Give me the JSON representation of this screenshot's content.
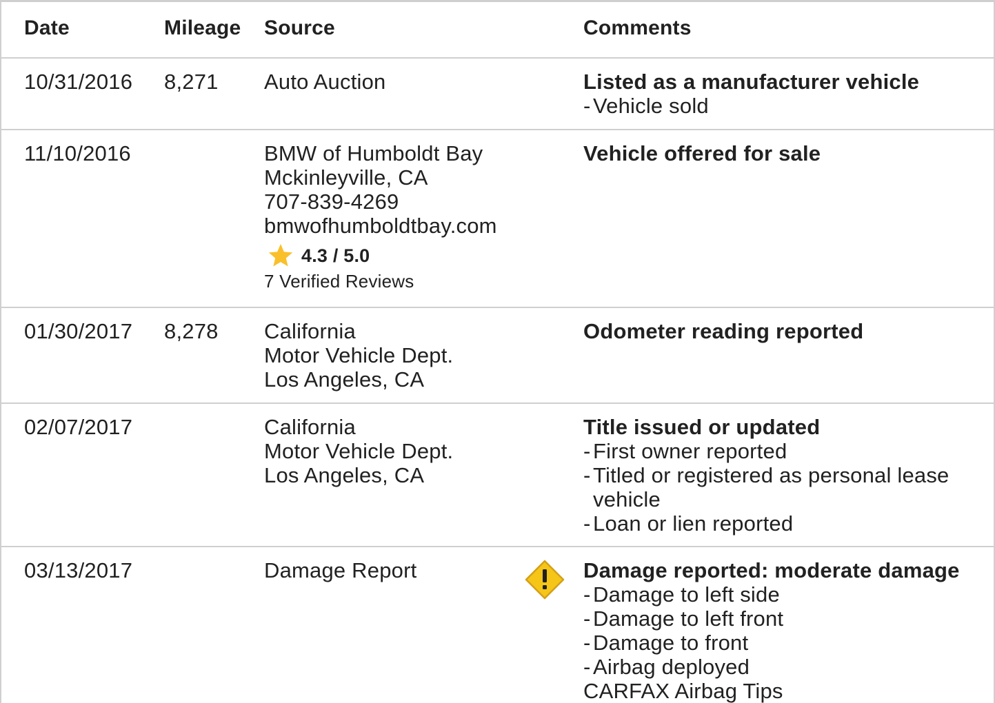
{
  "header": {
    "date": "Date",
    "mileage": "Mileage",
    "source": "Source",
    "comments": "Comments"
  },
  "rows": [
    {
      "date": "10/31/2016",
      "mileage": "8,271",
      "source": [
        "Auto Auction"
      ],
      "comment_title": "Listed as a manufacturer vehicle",
      "bullets": [
        "Vehicle sold"
      ]
    },
    {
      "date": "11/10/2016",
      "mileage": "",
      "source": [
        "BMW of Humboldt Bay",
        "Mckinleyville, CA",
        "707-839-4269",
        "bmwofhumboldtbay.com"
      ],
      "rating": "4.3 / 5.0",
      "reviews": "7 Verified Reviews",
      "comment_title": "Vehicle offered for sale",
      "bullets": []
    },
    {
      "date": "01/30/2017",
      "mileage": "8,278",
      "source": [
        "California",
        "Motor Vehicle Dept.",
        "Los Angeles, CA"
      ],
      "comment_title": "Odometer reading reported",
      "bullets": []
    },
    {
      "date": "02/07/2017",
      "mileage": "",
      "source": [
        "California",
        "Motor Vehicle Dept.",
        "Los Angeles, CA"
      ],
      "comment_title": "Title issued or updated",
      "bullets": [
        "First owner reported",
        "Titled or registered as personal lease vehicle",
        "Loan or lien reported"
      ]
    },
    {
      "date": "03/13/2017",
      "mileage": "",
      "source": [
        "Damage Report"
      ],
      "icon": "warning-diamond-icon",
      "comment_title": "Damage reported: moderate damage",
      "bullets": [
        "Damage to left side",
        "Damage to left front",
        "Damage to front",
        "Airbag deployed"
      ],
      "footer_link": "CARFAX Airbag Tips"
    }
  ],
  "colors": {
    "border": "#cfcfcf",
    "star": "#f9c02b",
    "warning": "#f5c518",
    "warning_border": "#d4a017",
    "text": "#212121"
  }
}
